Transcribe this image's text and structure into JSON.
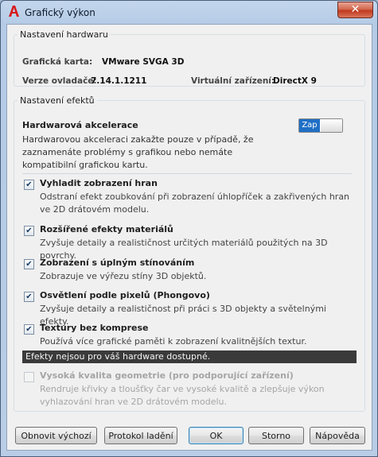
{
  "window": {
    "title": "Grafický výkon",
    "close_label": "✕"
  },
  "hardware": {
    "legend": "Nastavení hardwaru",
    "card_label": "Grafická karta:",
    "card_value": "VMware SVGA 3D",
    "driver_label": "Verze ovladače:",
    "driver_value": "7.14.1.1211",
    "virtual_label": "Virtuální zařízení:",
    "virtual_value": "DirectX 9"
  },
  "effects": {
    "legend": "Nastavení efektů",
    "accel_title": "Hardwarová akcelerace",
    "accel_desc": "Hardwarovou akceleraci zakažte pouze v případě, že zaznamenáte problémy s grafikou nebo nemáte kompatibilní grafickou kartu.",
    "toggle_label": "Zap",
    "items": [
      {
        "title": "Vyhladit zobrazení hran",
        "desc": "Odstraní efekt zoubkování při zobrazení úhlopříček a zakřivených hran ve 2D drátovém modelu.",
        "checked": true
      },
      {
        "title": "Rozšířené efekty materiálů",
        "desc": "Zvyšuje detaily a realističnost určitých materiálů použitých na 3D povrchy.",
        "checked": true
      },
      {
        "title": "Zobrazení s úplným stínováním",
        "desc": "Zobrazuje ve výřezu stíny 3D objektů.",
        "checked": true
      },
      {
        "title": "Osvětlení podle pixelů (Phongovo)",
        "desc": "Zvyšuje detaily a realističnost při práci s 3D objekty a světelnými efekty.",
        "checked": true
      },
      {
        "title": "Textury bez komprese",
        "desc": "Používá více grafické paměti k zobrazení kvalitnějších textur.",
        "checked": true
      }
    ],
    "notice": "Efekty nejsou pro váš hardware dostupné.",
    "unavailable": {
      "title": "Vysoká kvalita geometrie (pro podporující zařízení)",
      "desc": "Rendruje křivky a tloušťky čar ve vysoké kvalitě a zlepšuje výkon vyhlazování hran ve 2D drátovém modelu.",
      "checked": false
    }
  },
  "buttons": {
    "restore": "Obnovit výchozí",
    "log": "Protokol ladění",
    "ok": "OK",
    "cancel": "Storno",
    "help": "Nápověda"
  },
  "colors": {
    "toggle_on": "#1f6fc5",
    "notice_bg": "#3a3a3a",
    "title_bar": "#b5cbe6"
  }
}
